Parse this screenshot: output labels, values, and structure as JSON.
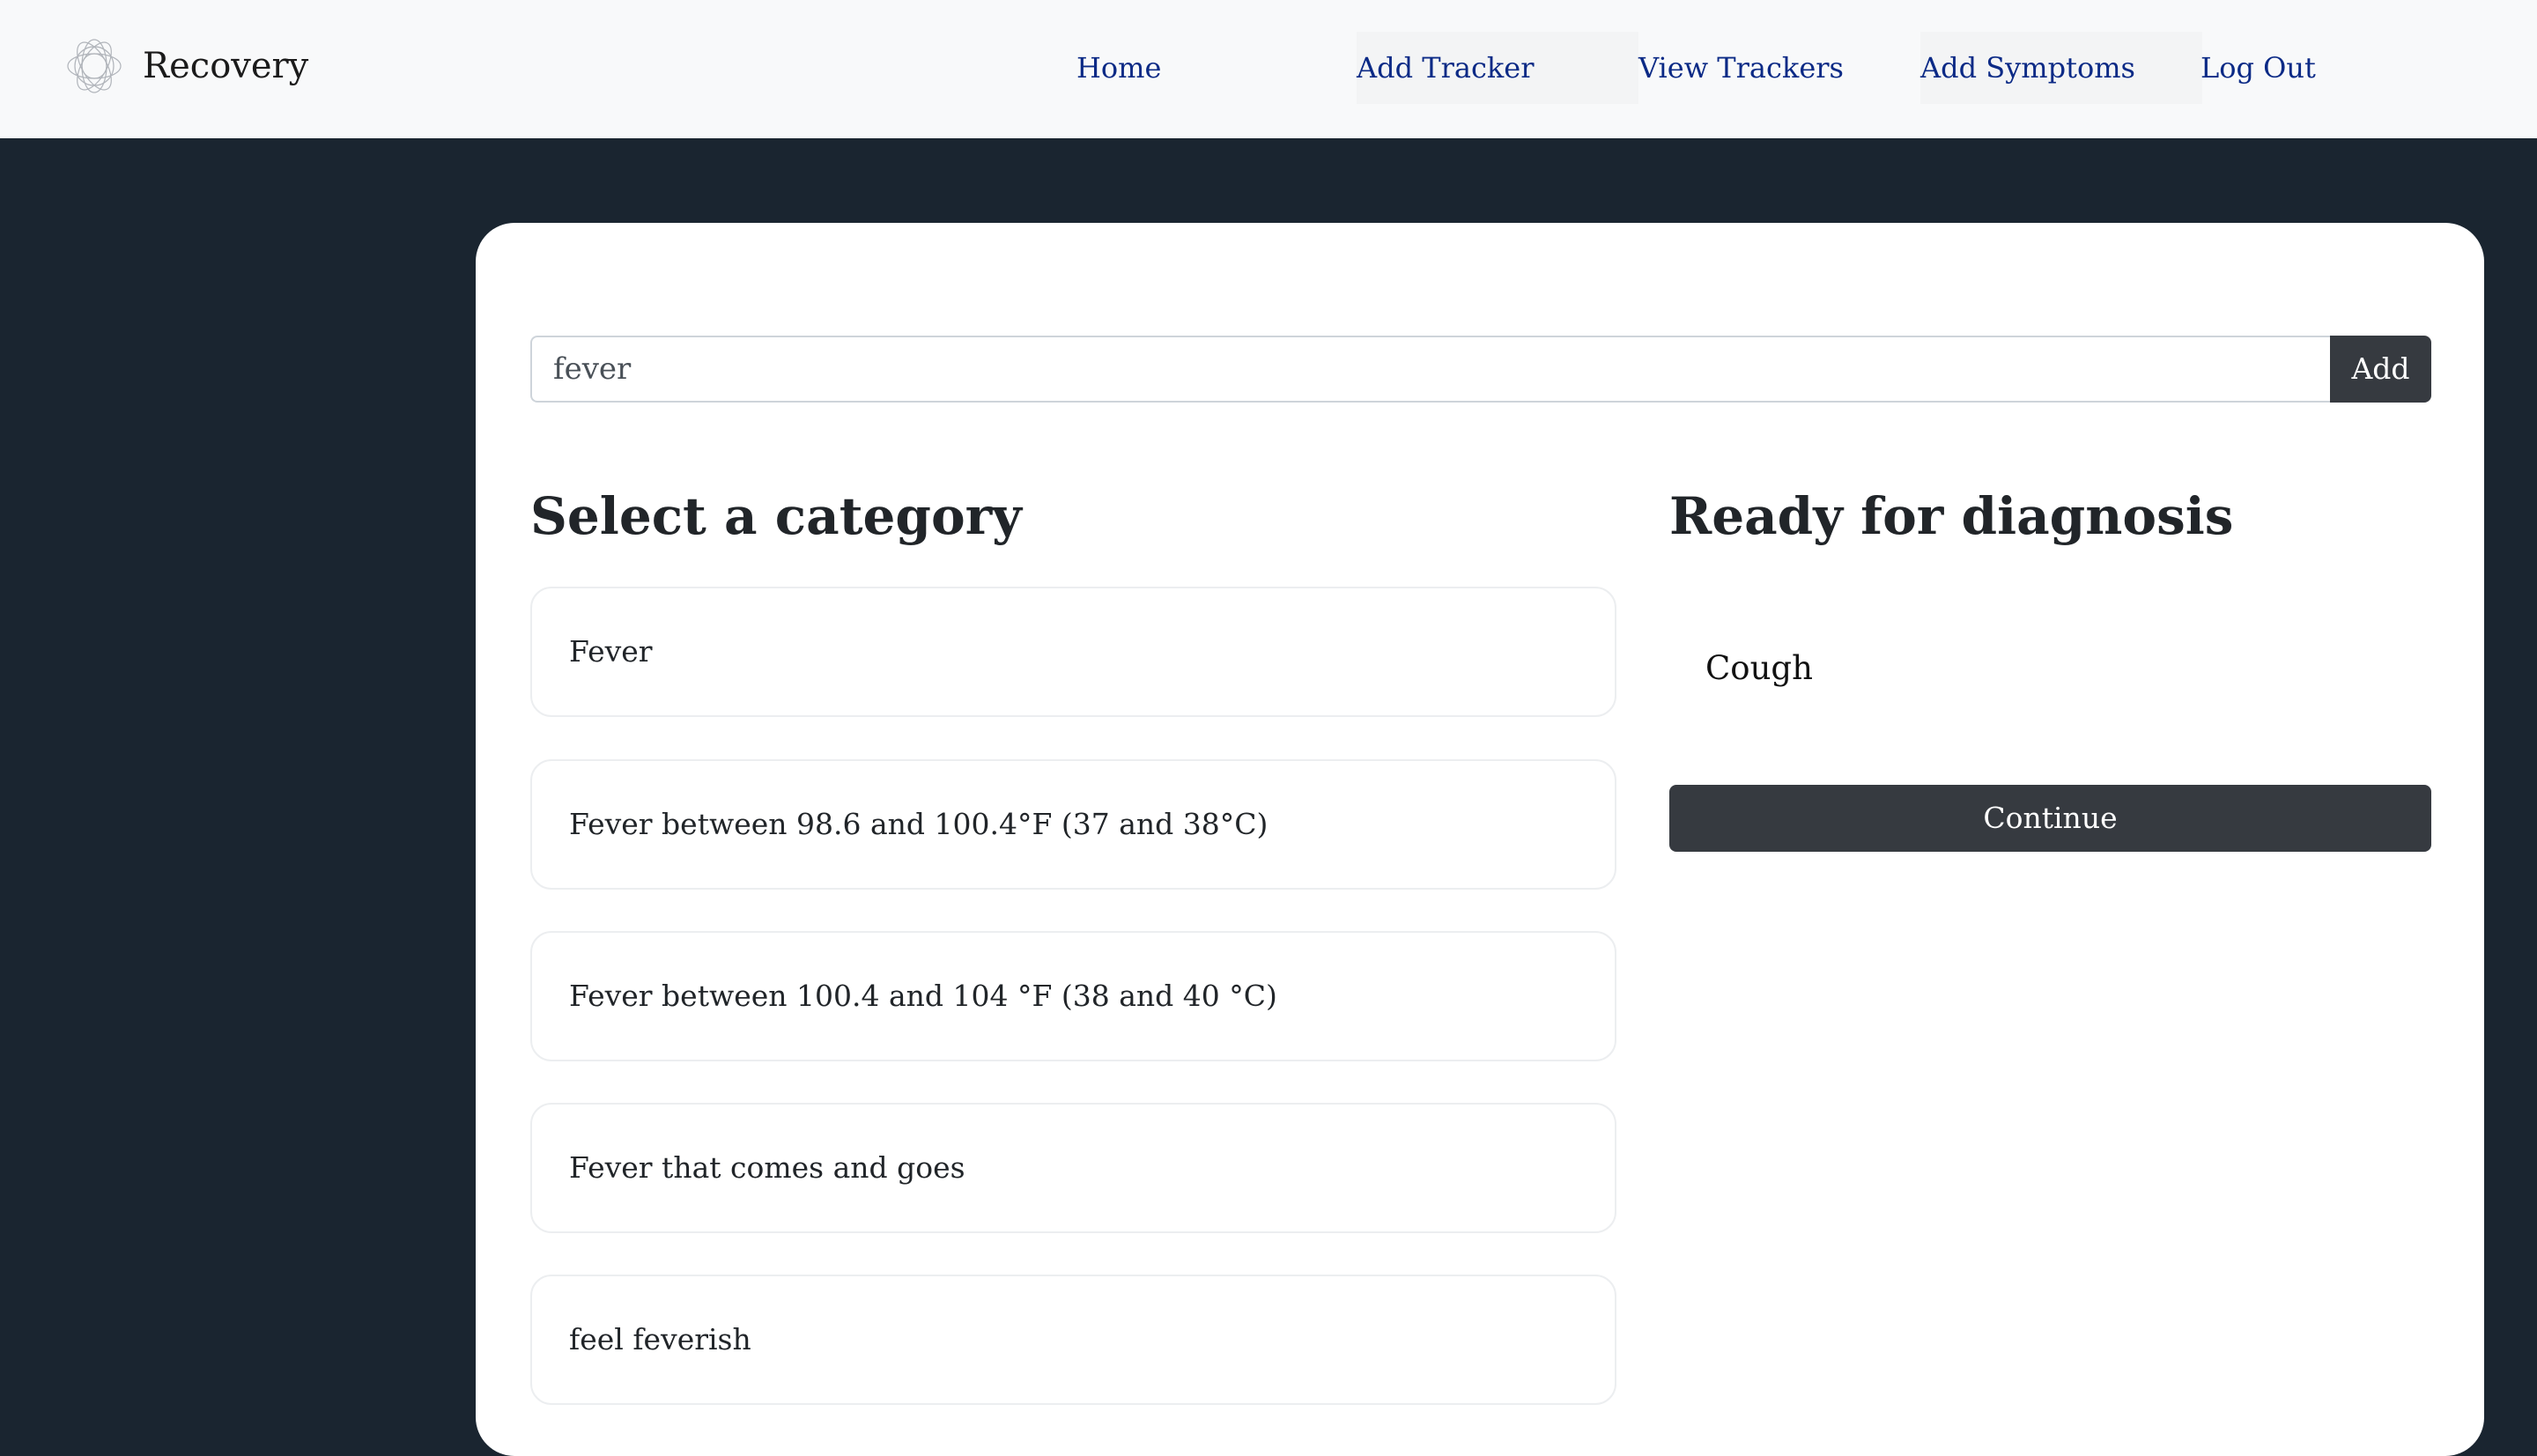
{
  "navbar": {
    "brand": "Recovery",
    "links": [
      {
        "label": "Home"
      },
      {
        "label": "Add Tracker"
      },
      {
        "label": "View Trackers"
      },
      {
        "label": "Add Symptoms"
      },
      {
        "label": "Log Out"
      }
    ]
  },
  "search": {
    "value": "fever",
    "button_label": "Add"
  },
  "categories": {
    "title": "Select a category",
    "items": [
      {
        "label": "Fever"
      },
      {
        "label": "Fever between 98.6 and 100.4°F (37 and 38°C)"
      },
      {
        "label": "Fever between 100.4 and 104 °F (38 and 40 °C)"
      },
      {
        "label": "Fever that comes and goes"
      },
      {
        "label": "feel feverish"
      }
    ]
  },
  "diagnosis": {
    "title": "Ready for diagnosis",
    "items": [
      {
        "label": "Cough"
      }
    ],
    "continue_label": "Continue"
  },
  "colors": {
    "navbar_bg": "#f8f9fa",
    "nav_link": "#0b2a86",
    "page_bg": "#1a2530",
    "button_dark": "#363a40"
  }
}
